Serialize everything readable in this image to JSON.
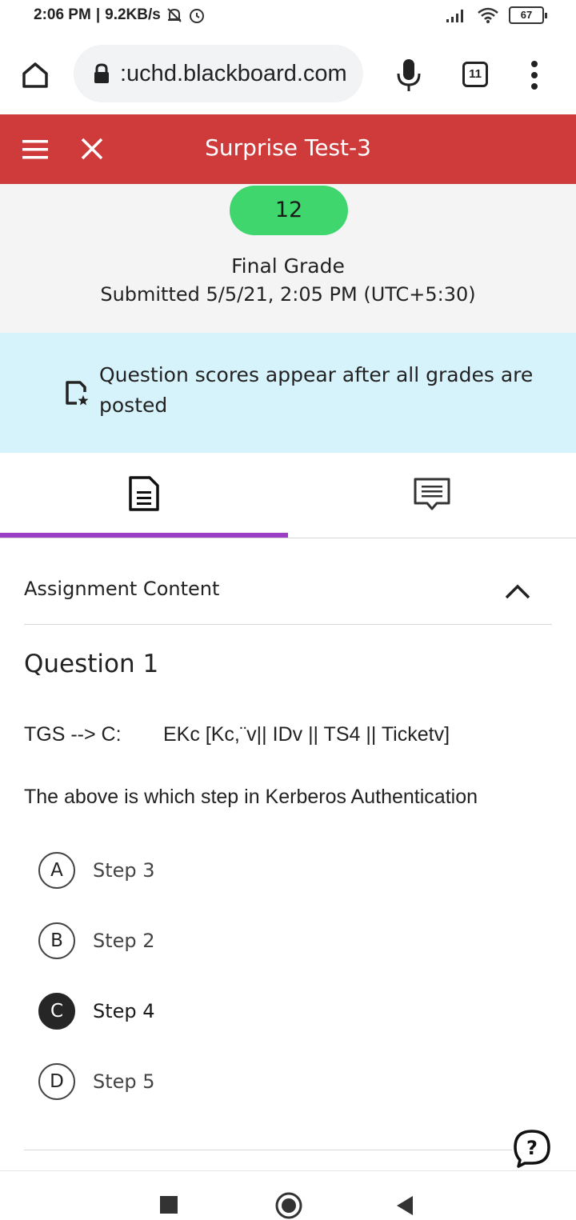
{
  "status_bar": {
    "time": "2:06 PM",
    "speed": "9.2KB/s",
    "battery": "67"
  },
  "browser": {
    "url": ":uchd.blackboard.com",
    "tab_count": "11"
  },
  "header": {
    "title": "Surprise Test-3",
    "color": "#cf3b3b"
  },
  "grade": {
    "value": "12",
    "label": "Final Grade",
    "submitted": "Submitted 5/5/21, 2:05 PM (UTC+5:30)"
  },
  "notice": {
    "text": "Question scores appear after all grades are posted"
  },
  "tabs": [
    {
      "icon": "document-icon",
      "active": true
    },
    {
      "icon": "comment-icon",
      "active": false
    }
  ],
  "content": {
    "section_heading": "Assignment Content",
    "question_title": "Question 1",
    "question_line_left": "TGS --> C:",
    "question_line_right": "EKc [Kc,¨v|| IDv || TS4 || Ticketv]",
    "question_text": "The above is which step in Kerberos Authentication",
    "options": [
      {
        "letter": "A",
        "label": "Step 3",
        "selected": false
      },
      {
        "letter": "B",
        "label": "Step 2",
        "selected": false
      },
      {
        "letter": "C",
        "label": "Step 4",
        "selected": true
      },
      {
        "letter": "D",
        "label": "Step 5",
        "selected": false
      }
    ]
  },
  "colors": {
    "accent_purple": "#9b3fc4",
    "grade_green": "#3fd66e",
    "notice_blue": "#d6f2fb"
  }
}
